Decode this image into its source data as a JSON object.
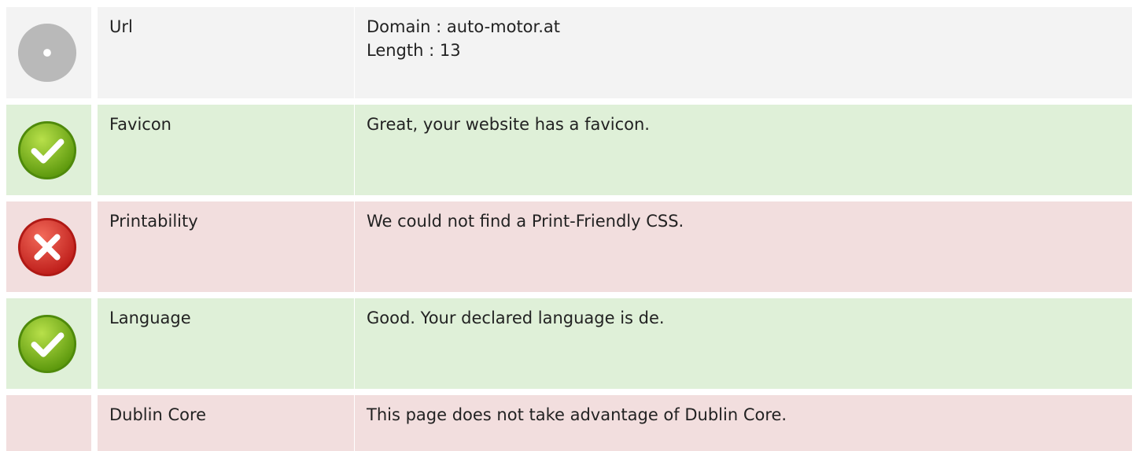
{
  "colors": {
    "neutral_bg": "#f3f3f3",
    "success_bg": "#dff0d8",
    "error_bg": "#f2dede",
    "text": "#222222"
  },
  "rows": [
    {
      "label": "Url",
      "status": "neutral",
      "icon": "info-dot-icon",
      "lines": [
        "Domain : auto-motor.at",
        "Length : 13"
      ]
    },
    {
      "label": "Favicon",
      "status": "success",
      "icon": "check-icon",
      "lines": [
        "Great, your website has a favicon."
      ]
    },
    {
      "label": "Printability",
      "status": "error",
      "icon": "cross-icon",
      "lines": [
        "We could not find a Print-Friendly CSS."
      ]
    },
    {
      "label": "Language",
      "status": "success",
      "icon": "check-icon",
      "lines": [
        "Good. Your declared language is de."
      ]
    },
    {
      "label": "Dublin Core",
      "status": "error",
      "icon": "",
      "lines": [
        "This page does not take advantage of Dublin Core."
      ]
    }
  ]
}
